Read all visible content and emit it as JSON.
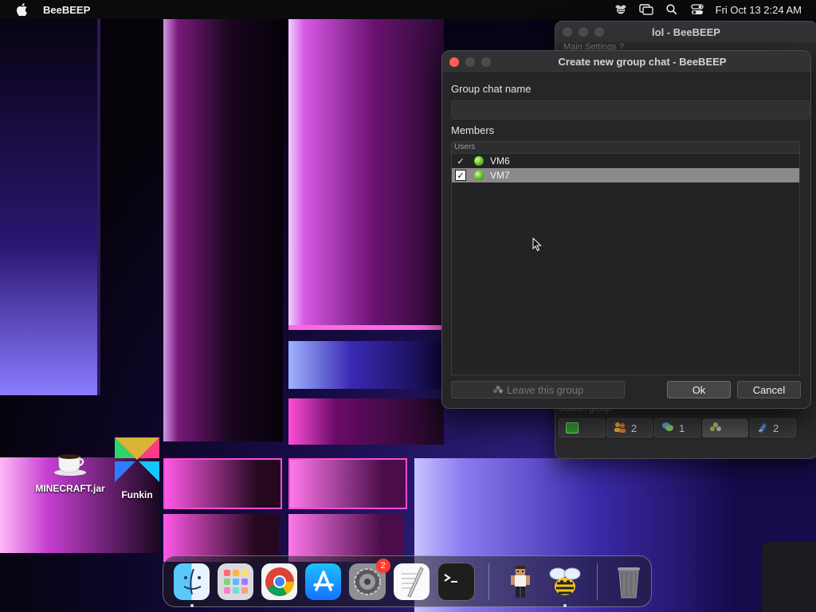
{
  "menubar": {
    "app_name": "BeeBEEP",
    "clock": "Fri Oct 13  2:24 AM",
    "icons": [
      "apple-icon",
      "beebeep-status-icon",
      "screen-mirroring-icon",
      "spotlight-search-icon",
      "control-center-icon"
    ]
  },
  "main_window": {
    "title": "lol - BeeBEEP",
    "menu_text": "Main   Settings   ?",
    "search_placeholder": "Search group",
    "tabs": [
      {
        "icon": "chat-green-icon",
        "count": ""
      },
      {
        "icon": "users-icon",
        "count": "2"
      },
      {
        "icon": "chat-bubbles-icon",
        "count": "1"
      },
      {
        "icon": "group-icon",
        "count": ""
      },
      {
        "icon": "file-share-icon",
        "count": "2"
      }
    ]
  },
  "dialog": {
    "title": "Create new group chat - BeeBEEP",
    "group_name_label": "Group chat name",
    "group_name_value": "",
    "members_label": "Members",
    "list_header": "Users",
    "users": [
      {
        "name": "VM6",
        "checked": true,
        "selected": false,
        "status_color": "#5fbf1f"
      },
      {
        "name": "VM7",
        "checked": true,
        "selected": true,
        "status_color": "#5fbf1f"
      }
    ],
    "leave_button": "Leave this group",
    "ok_button": "Ok",
    "cancel_button": "Cancel"
  },
  "desktop": {
    "icons": [
      {
        "label": "MINECRAFT.jar",
        "icon": "java-coffee-icon"
      },
      {
        "label": "Funkin",
        "icon": "funkin-icon"
      }
    ]
  },
  "dock": {
    "items": [
      {
        "name": "Finder",
        "icon": "finder-icon",
        "running": true
      },
      {
        "name": "Launchpad",
        "icon": "launchpad-icon",
        "running": false
      },
      {
        "name": "Google Chrome",
        "icon": "chrome-icon",
        "running": false
      },
      {
        "name": "App Store",
        "icon": "app-store-icon",
        "running": false
      },
      {
        "name": "System Settings",
        "icon": "settings-gear-icon",
        "running": false,
        "badge": "2"
      },
      {
        "name": "TextEdit",
        "icon": "textedit-icon",
        "running": false
      },
      {
        "name": "Terminal",
        "icon": "terminal-icon",
        "running": false
      },
      {
        "name": "Minecraft",
        "icon": "minecraft-character-icon",
        "running": false
      },
      {
        "name": "BeeBEEP",
        "icon": "bee-icon",
        "running": true
      },
      {
        "name": "Trash",
        "icon": "trash-icon",
        "running": false
      }
    ]
  },
  "colors": {
    "close_button": "#ff5f57",
    "online_status": "#5fbf1f",
    "badge": "#ff3b30"
  }
}
